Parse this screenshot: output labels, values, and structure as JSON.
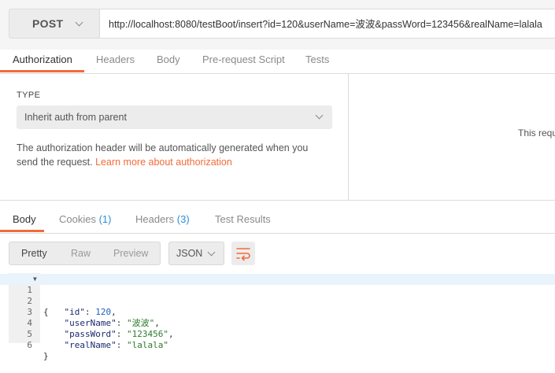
{
  "request": {
    "method": "POST",
    "url": "http://localhost:8080/testBoot/insert?id=120&userName=波波&passWord=123456&realName=lalala"
  },
  "request_tabs": [
    "Authorization",
    "Headers",
    "Body",
    "Pre-request Script",
    "Tests"
  ],
  "auth": {
    "type_label": "TYPE",
    "type_value": "Inherit auth from parent",
    "description": "The authorization header will be automatically generated when you send the request.",
    "learn_more": "Learn more about authorization",
    "right_panel_text": "This requ"
  },
  "response_tabs": {
    "body": "Body",
    "cookies": "Cookies",
    "cookies_count": "(1)",
    "headers": "Headers",
    "headers_count": "(3)",
    "test_results": "Test Results"
  },
  "view_options": [
    "Pretty",
    "Raw",
    "Preview"
  ],
  "format": "JSON",
  "code_lines": [
    {
      "no": "1",
      "text": "{"
    },
    {
      "no": "2",
      "key": "\"id\"",
      "value": "120",
      "trail": ","
    },
    {
      "no": "3",
      "key": "\"userName\"",
      "value": "\"波波\"",
      "trail": ","
    },
    {
      "no": "4",
      "key": "\"passWord\"",
      "value": "\"123456\"",
      "trail": ","
    },
    {
      "no": "5",
      "key": "\"realName\"",
      "value": "\"lalala\"",
      "trail": ""
    },
    {
      "no": "6",
      "text": "}"
    }
  ],
  "colors": {
    "accent": "#f26b3a",
    "count_blue": "#2c8ed6",
    "json_string": "#2c7a2c",
    "json_number": "#1a5fbf",
    "json_key": "#1c2a6e"
  }
}
